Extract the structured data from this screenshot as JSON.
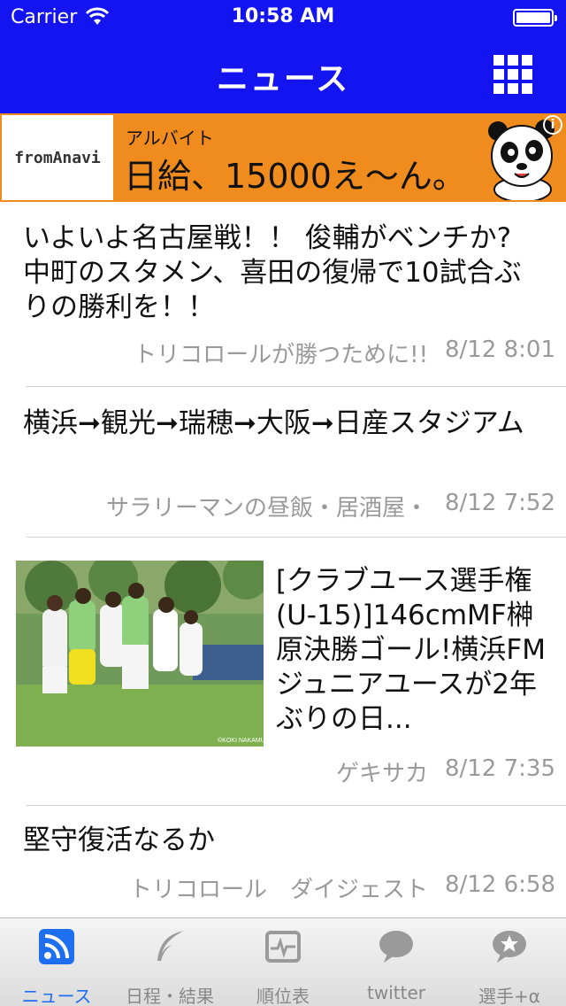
{
  "status_bar": {
    "carrier": "Carrier",
    "time": "10:58 AM"
  },
  "nav": {
    "title": "ニュース",
    "menu_icon": "grid-icon"
  },
  "ad": {
    "logo": "fromAnavi",
    "subtitle": "アルバイト",
    "headline": "日給、15000え〜ん。",
    "info_icon": "i"
  },
  "articles": [
    {
      "title": "いよいよ名古屋戦！！ 俊輔がベンチか? 中町のスタメン、喜田の復帰で10試合ぶりの勝利を！！",
      "source": "トリコロールが勝つために!!",
      "date": "8/12 8:01"
    },
    {
      "title": "横浜➞観光➞瑞穂➞大阪➞日産スタジアム",
      "source": "サラリーマンの昼飯・居酒屋・",
      "date": "8/12 7:52"
    },
    {
      "title": "[クラブユース選手権(U-15)]146cmMF榊原決勝ゴール!横浜FMジュニアユースが2年ぶりの日...",
      "source": "ゲキサカ",
      "date": "8/12 7:35",
      "photo_credit": "©KOKI NAKAMURA"
    },
    {
      "title": "堅守復活なるか",
      "source": "トリコロール　ダイジェスト",
      "date": "8/12 6:58"
    }
  ],
  "tabs": [
    {
      "label": "ニュース",
      "icon": "rss-icon",
      "active": true
    },
    {
      "label": "日程・結果",
      "icon": "feather-icon",
      "active": false
    },
    {
      "label": "順位表",
      "icon": "monitor-icon",
      "active": false
    },
    {
      "label": "twitter",
      "icon": "speech-bubble-icon",
      "active": false
    },
    {
      "label": "選手+α",
      "icon": "star-bubble-icon",
      "active": false
    }
  ],
  "colors": {
    "header": "#1414f0",
    "ad": "#f08c1e",
    "active_tab": "#1e6ef0",
    "meta_text": "#9a9a9a"
  }
}
